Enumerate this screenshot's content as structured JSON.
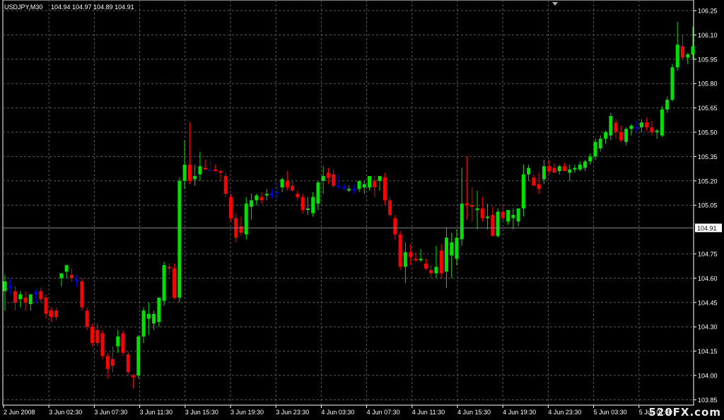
{
  "header": {
    "symbol": "USDJPY,M30",
    "ohlc": "104.94 104.97 104.89 104.91"
  },
  "watermark": "520FX.com",
  "colors": {
    "background": "#000000",
    "grid": "#5a5a5a",
    "axis": "#ffffff",
    "bull": "#00e000",
    "bear": "#ff0000",
    "doji": "#0000ff",
    "price_line": "#8a8a8a"
  },
  "chart_data": {
    "type": "candlestick",
    "symbol": "USDJPY",
    "timeframe": "M30",
    "ylim": [
      103.8,
      106.3
    ],
    "y_ticks": [
      "106.25",
      "106.10",
      "105.95",
      "105.80",
      "105.65",
      "105.50",
      "105.35",
      "105.20",
      "105.05",
      "104.91",
      "104.75",
      "104.60",
      "104.45",
      "104.30",
      "104.15",
      "104.00",
      "103.85"
    ],
    "x_ticks": [
      "2 Jun 2008",
      "3 Jun 02:30",
      "3 Jun 07:30",
      "3 Jun 11:30",
      "3 Jun 15:30",
      "3 Jun 19:30",
      "3 Jun 23:30",
      "4 Jun 03:30",
      "4 Jun 07:30",
      "4 Jun 11:30",
      "4 Jun 15:30",
      "4 Jun 19:30",
      "4 Jun 23:30",
      "5 Jun 03:30",
      "5 Jun 07:30"
    ],
    "current_price": "104.91",
    "candles": [
      {
        "o": 104.52,
        "h": 104.62,
        "l": 104.4,
        "c": 104.58
      },
      {
        "o": 104.55,
        "h": 104.6,
        "l": 104.5,
        "c": 104.55
      },
      {
        "o": 104.52,
        "h": 104.55,
        "l": 104.4,
        "c": 104.45
      },
      {
        "o": 104.47,
        "h": 104.52,
        "l": 104.42,
        "c": 104.5
      },
      {
        "o": 104.48,
        "h": 104.52,
        "l": 104.4,
        "c": 104.45
      },
      {
        "o": 104.44,
        "h": 104.5,
        "l": 104.4,
        "c": 104.5
      },
      {
        "o": 104.51,
        "h": 104.53,
        "l": 104.45,
        "c": 104.51
      },
      {
        "o": 104.52,
        "h": 104.54,
        "l": 104.45,
        "c": 104.47
      },
      {
        "o": 104.48,
        "h": 104.5,
        "l": 104.35,
        "c": 104.38
      },
      {
        "o": 104.4,
        "h": 104.42,
        "l": 104.33,
        "c": 104.36
      },
      {
        "o": 104.4,
        "h": 104.42,
        "l": 104.34,
        "c": 104.36
      },
      {
        "o": 104.6,
        "h": 104.63,
        "l": 104.55,
        "c": 104.63
      },
      {
        "o": 104.64,
        "h": 104.67,
        "l": 104.6,
        "c": 104.68
      },
      {
        "o": 104.62,
        "h": 104.66,
        "l": 104.58,
        "c": 104.6
      },
      {
        "o": 104.59,
        "h": 104.62,
        "l": 104.55,
        "c": 104.59
      },
      {
        "o": 104.58,
        "h": 104.6,
        "l": 104.4,
        "c": 104.42
      },
      {
        "o": 104.4,
        "h": 104.42,
        "l": 104.28,
        "c": 104.3
      },
      {
        "o": 104.3,
        "h": 104.32,
        "l": 104.18,
        "c": 104.2
      },
      {
        "o": 104.28,
        "h": 104.32,
        "l": 104.18,
        "c": 104.2
      },
      {
        "o": 104.26,
        "h": 104.28,
        "l": 104.1,
        "c": 104.12
      },
      {
        "o": 104.12,
        "h": 104.14,
        "l": 103.98,
        "c": 104.04
      },
      {
        "o": 104.1,
        "h": 104.18,
        "l": 104.02,
        "c": 104.06
      },
      {
        "o": 104.18,
        "h": 104.28,
        "l": 104.14,
        "c": 104.24
      },
      {
        "o": 104.26,
        "h": 104.28,
        "l": 104.12,
        "c": 104.14
      },
      {
        "o": 104.13,
        "h": 104.15,
        "l": 104.0,
        "c": 104.02
      },
      {
        "o": 104.0,
        "h": 104.01,
        "l": 103.92,
        "c": 103.99
      },
      {
        "o": 104.0,
        "h": 104.25,
        "l": 103.98,
        "c": 104.24
      },
      {
        "o": 104.24,
        "h": 104.42,
        "l": 104.2,
        "c": 104.4
      },
      {
        "o": 104.35,
        "h": 104.45,
        "l": 104.25,
        "c": 104.38
      },
      {
        "o": 104.32,
        "h": 104.4,
        "l": 104.28,
        "c": 104.38
      },
      {
        "o": 104.33,
        "h": 104.48,
        "l": 104.3,
        "c": 104.48
      },
      {
        "o": 104.46,
        "h": 104.7,
        "l": 104.43,
        "c": 104.68
      },
      {
        "o": 104.67,
        "h": 104.69,
        "l": 104.62,
        "c": 104.66
      },
      {
        "o": 104.66,
        "h": 104.69,
        "l": 104.47,
        "c": 104.48
      },
      {
        "o": 104.48,
        "h": 105.22,
        "l": 104.45,
        "c": 105.2
      },
      {
        "o": 105.2,
        "h": 105.45,
        "l": 105.15,
        "c": 105.3
      },
      {
        "o": 105.3,
        "h": 105.56,
        "l": 105.18,
        "c": 105.2
      },
      {
        "o": 105.21,
        "h": 105.3,
        "l": 105.17,
        "c": 105.23
      },
      {
        "o": 105.24,
        "h": 105.38,
        "l": 105.2,
        "c": 105.29
      },
      {
        "o": 105.28,
        "h": 105.33,
        "l": 105.27,
        "c": 105.27
      },
      {
        "o": 105.27,
        "h": 105.33,
        "l": 105.26,
        "c": 105.27
      },
      {
        "o": 105.27,
        "h": 105.3,
        "l": 105.26,
        "c": 105.26
      },
      {
        "o": 105.26,
        "h": 105.27,
        "l": 105.2,
        "c": 105.25
      },
      {
        "o": 105.23,
        "h": 105.25,
        "l": 105.1,
        "c": 105.12
      },
      {
        "o": 105.1,
        "h": 105.12,
        "l": 104.95,
        "c": 104.97
      },
      {
        "o": 104.97,
        "h": 105.0,
        "l": 104.82,
        "c": 104.85
      },
      {
        "o": 104.92,
        "h": 104.98,
        "l": 104.86,
        "c": 104.88
      },
      {
        "o": 104.87,
        "h": 105.1,
        "l": 104.84,
        "c": 105.06
      },
      {
        "o": 105.04,
        "h": 105.12,
        "l": 104.96,
        "c": 105.08
      },
      {
        "o": 105.08,
        "h": 105.12,
        "l": 105.05,
        "c": 105.11
      },
      {
        "o": 105.1,
        "h": 105.13,
        "l": 105.06,
        "c": 105.08
      },
      {
        "o": 105.11,
        "h": 105.15,
        "l": 105.08,
        "c": 105.12
      },
      {
        "o": 105.12,
        "h": 105.15,
        "l": 105.09,
        "c": 105.12
      },
      {
        "o": 105.13,
        "h": 105.18,
        "l": 105.09,
        "c": 105.13
      },
      {
        "o": 105.16,
        "h": 105.22,
        "l": 105.13,
        "c": 105.21
      },
      {
        "o": 105.2,
        "h": 105.26,
        "l": 105.14,
        "c": 105.16
      },
      {
        "o": 105.17,
        "h": 105.2,
        "l": 105.14,
        "c": 105.14
      },
      {
        "o": 105.12,
        "h": 105.14,
        "l": 105.08,
        "c": 105.1
      },
      {
        "o": 105.1,
        "h": 105.12,
        "l": 105.0,
        "c": 105.02
      },
      {
        "o": 105.02,
        "h": 105.1,
        "l": 104.99,
        "c": 105.03
      },
      {
        "o": 105.0,
        "h": 105.13,
        "l": 104.98,
        "c": 105.1
      },
      {
        "o": 105.06,
        "h": 105.2,
        "l": 105.02,
        "c": 105.19
      },
      {
        "o": 105.2,
        "h": 105.29,
        "l": 105.12,
        "c": 105.23
      },
      {
        "o": 105.25,
        "h": 105.28,
        "l": 105.18,
        "c": 105.22
      },
      {
        "o": 105.24,
        "h": 105.27,
        "l": 105.16,
        "c": 105.17
      },
      {
        "o": 105.17,
        "h": 105.24,
        "l": 105.15,
        "c": 105.17
      },
      {
        "o": 105.16,
        "h": 105.18,
        "l": 105.14,
        "c": 105.16
      },
      {
        "o": 105.14,
        "h": 105.17,
        "l": 105.13,
        "c": 105.15
      },
      {
        "o": 105.15,
        "h": 105.18,
        "l": 105.12,
        "c": 105.15
      },
      {
        "o": 105.15,
        "h": 105.19,
        "l": 105.13,
        "c": 105.2
      },
      {
        "o": 105.16,
        "h": 105.2,
        "l": 105.12,
        "c": 105.18
      },
      {
        "o": 105.16,
        "h": 105.2,
        "l": 105.14,
        "c": 105.23
      },
      {
        "o": 105.2,
        "h": 105.23,
        "l": 105.1,
        "c": 105.16
      },
      {
        "o": 105.2,
        "h": 105.22,
        "l": 105.14,
        "c": 105.23
      },
      {
        "o": 105.22,
        "h": 105.25,
        "l": 105.05,
        "c": 105.08
      },
      {
        "o": 105.08,
        "h": 105.1,
        "l": 104.98,
        "c": 104.99
      },
      {
        "o": 104.97,
        "h": 104.99,
        "l": 104.84,
        "c": 104.87
      },
      {
        "o": 104.87,
        "h": 104.89,
        "l": 104.65,
        "c": 104.67
      },
      {
        "o": 104.67,
        "h": 104.82,
        "l": 104.57,
        "c": 104.76
      },
      {
        "o": 104.76,
        "h": 104.81,
        "l": 104.68,
        "c": 104.73
      },
      {
        "o": 104.72,
        "h": 104.76,
        "l": 104.7,
        "c": 104.71
      },
      {
        "o": 104.71,
        "h": 104.78,
        "l": 104.7,
        "c": 104.72
      },
      {
        "o": 104.69,
        "h": 104.72,
        "l": 104.65,
        "c": 104.66
      },
      {
        "o": 104.65,
        "h": 104.68,
        "l": 104.6,
        "c": 104.63
      },
      {
        "o": 104.63,
        "h": 104.8,
        "l": 104.6,
        "c": 104.67
      },
      {
        "o": 104.77,
        "h": 104.81,
        "l": 104.6,
        "c": 104.63
      },
      {
        "o": 104.64,
        "h": 104.91,
        "l": 104.54,
        "c": 104.85
      },
      {
        "o": 104.74,
        "h": 104.88,
        "l": 104.6,
        "c": 104.82
      },
      {
        "o": 104.72,
        "h": 104.9,
        "l": 104.68,
        "c": 104.85
      },
      {
        "o": 104.84,
        "h": 105.28,
        "l": 104.8,
        "c": 105.06
      },
      {
        "o": 105.06,
        "h": 105.35,
        "l": 104.96,
        "c": 105.05
      },
      {
        "o": 105.05,
        "h": 105.16,
        "l": 104.95,
        "c": 105.04
      },
      {
        "o": 105.02,
        "h": 105.14,
        "l": 104.9,
        "c": 105.03
      },
      {
        "o": 105.03,
        "h": 105.1,
        "l": 104.95,
        "c": 104.97
      },
      {
        "o": 104.97,
        "h": 105.06,
        "l": 104.9,
        "c": 104.98
      },
      {
        "o": 104.99,
        "h": 105.04,
        "l": 104.88,
        "c": 104.86
      },
      {
        "o": 104.86,
        "h": 105.03,
        "l": 104.85,
        "c": 105.01
      },
      {
        "o": 105.01,
        "h": 105.05,
        "l": 104.95,
        "c": 104.97
      },
      {
        "o": 104.95,
        "h": 105.02,
        "l": 104.93,
        "c": 105.02
      },
      {
        "o": 104.97,
        "h": 105.03,
        "l": 104.9,
        "c": 104.99
      },
      {
        "o": 104.95,
        "h": 105.03,
        "l": 104.92,
        "c": 105.03
      },
      {
        "o": 105.03,
        "h": 105.3,
        "l": 104.98,
        "c": 105.24
      },
      {
        "o": 105.24,
        "h": 105.3,
        "l": 105.2,
        "c": 105.28
      },
      {
        "o": 105.22,
        "h": 105.24,
        "l": 105.17,
        "c": 105.17
      },
      {
        "o": 105.18,
        "h": 105.25,
        "l": 105.12,
        "c": 105.15
      },
      {
        "o": 105.21,
        "h": 105.33,
        "l": 105.18,
        "c": 105.29
      },
      {
        "o": 105.29,
        "h": 105.33,
        "l": 105.24,
        "c": 105.26
      },
      {
        "o": 105.28,
        "h": 105.31,
        "l": 105.25,
        "c": 105.25
      },
      {
        "o": 105.26,
        "h": 105.3,
        "l": 105.24,
        "c": 105.29
      },
      {
        "o": 105.29,
        "h": 105.31,
        "l": 105.26,
        "c": 105.26
      },
      {
        "o": 105.25,
        "h": 105.3,
        "l": 105.2,
        "c": 105.27
      },
      {
        "o": 105.27,
        "h": 105.3,
        "l": 105.25,
        "c": 105.28
      },
      {
        "o": 105.27,
        "h": 105.32,
        "l": 105.26,
        "c": 105.3
      },
      {
        "o": 105.28,
        "h": 105.33,
        "l": 105.26,
        "c": 105.32
      },
      {
        "o": 105.32,
        "h": 105.37,
        "l": 105.3,
        "c": 105.35
      },
      {
        "o": 105.35,
        "h": 105.46,
        "l": 105.33,
        "c": 105.44
      },
      {
        "o": 105.4,
        "h": 105.48,
        "l": 105.38,
        "c": 105.46
      },
      {
        "o": 105.46,
        "h": 105.51,
        "l": 105.43,
        "c": 105.5
      },
      {
        "o": 105.48,
        "h": 105.62,
        "l": 105.45,
        "c": 105.6
      },
      {
        "o": 105.56,
        "h": 105.58,
        "l": 105.46,
        "c": 105.5
      },
      {
        "o": 105.5,
        "h": 105.54,
        "l": 105.44,
        "c": 105.45
      },
      {
        "o": 105.44,
        "h": 105.53,
        "l": 105.42,
        "c": 105.52
      },
      {
        "o": 105.52,
        "h": 105.55,
        "l": 105.48,
        "c": 105.54
      },
      {
        "o": 105.53,
        "h": 105.57,
        "l": 105.5,
        "c": 105.53
      },
      {
        "o": 105.53,
        "h": 105.58,
        "l": 105.5,
        "c": 105.56
      },
      {
        "o": 105.56,
        "h": 105.59,
        "l": 105.51,
        "c": 105.53
      },
      {
        "o": 105.53,
        "h": 105.57,
        "l": 105.48,
        "c": 105.5
      },
      {
        "o": 105.5,
        "h": 105.52,
        "l": 105.46,
        "c": 105.51
      },
      {
        "o": 105.48,
        "h": 105.66,
        "l": 105.47,
        "c": 105.64
      },
      {
        "o": 105.64,
        "h": 105.72,
        "l": 105.62,
        "c": 105.7
      },
      {
        "o": 105.7,
        "h": 105.92,
        "l": 105.69,
        "c": 105.9
      },
      {
        "o": 105.9,
        "h": 106.18,
        "l": 105.88,
        "c": 106.04
      },
      {
        "o": 106.03,
        "h": 106.1,
        "l": 105.95,
        "c": 105.96
      },
      {
        "o": 105.96,
        "h": 105.99,
        "l": 105.92,
        "c": 105.98
      },
      {
        "o": 105.98,
        "h": 106.15,
        "l": 105.95,
        "c": 106.03
      }
    ]
  }
}
